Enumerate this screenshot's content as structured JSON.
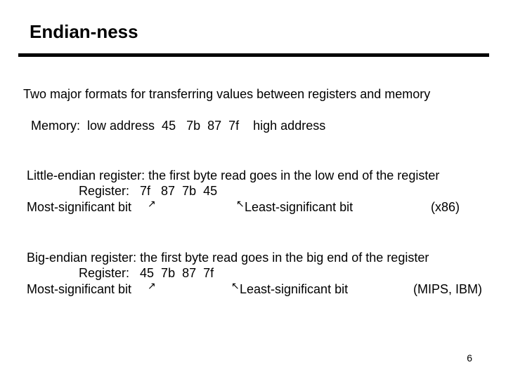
{
  "title": "Endian-ness",
  "intro": "Two major formats for transferring values between registers and memory",
  "memory_row": "Memory:  low address  45   7b  87  7f    high address",
  "little": {
    "heading": "Little-endian register: the first byte read goes in the low end of the register",
    "register_row": "Register:   7f   87  7b  45",
    "msb": "Most-significant bit",
    "lsb": "Least-significant bit",
    "arch": "(x86)"
  },
  "big": {
    "heading": "Big-endian register: the first byte read goes in the big end of the register",
    "register_row": "Register:   45  7b  87  7f",
    "msb": "Most-significant bit",
    "lsb": "Least-significant bit",
    "arch": "(MIPS, IBM)"
  },
  "arrows": {
    "up_right": "↗",
    "up_left": "↖"
  },
  "page_number": "6"
}
